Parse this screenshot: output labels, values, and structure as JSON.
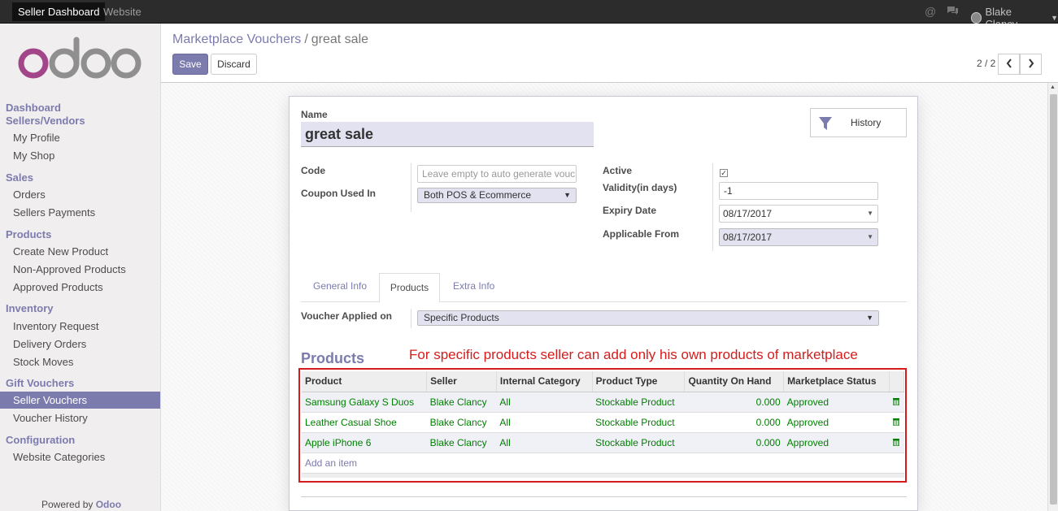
{
  "topbar": {
    "tabs": [
      "Seller Dashboard",
      "Website"
    ],
    "icons": [
      "at-icon",
      "chat-icon"
    ],
    "user_name": "Blake Clancy"
  },
  "sidebar": {
    "logo": "odoo",
    "sections": [
      {
        "head": "Dashboard",
        "items": []
      },
      {
        "head": "Sellers/Vendors",
        "items": [
          "My Profile",
          "My Shop"
        ]
      },
      {
        "head": "Sales",
        "items": [
          "Orders",
          "Sellers Payments"
        ]
      },
      {
        "head": "Products",
        "items": [
          "Create New Product",
          "Non-Approved Products",
          "Approved Products"
        ]
      },
      {
        "head": "Inventory",
        "items": [
          "Inventory Request",
          "Delivery Orders",
          "Stock Moves"
        ]
      },
      {
        "head": "Gift Vouchers",
        "items": [
          "Seller Vouchers",
          "Voucher History"
        ]
      },
      {
        "head": "Configuration",
        "items": [
          "Website Categories"
        ]
      }
    ],
    "active_item": "Seller Vouchers",
    "powered_prefix": "Powered by",
    "powered_brand": "Odoo"
  },
  "control": {
    "breadcrumb_parent": "Marketplace Vouchers",
    "breadcrumb_sep": "/",
    "breadcrumb_current": "great sale",
    "save_label": "Save",
    "discard_label": "Discard",
    "pager": "2 / 2"
  },
  "form": {
    "name_label": "Name",
    "name_value": "great sale",
    "history_label": "History",
    "code_label": "Code",
    "code_placeholder": "Leave empty to auto generate voucher code",
    "coupon_label": "Coupon Used In",
    "coupon_value": "Both POS & Ecommerce",
    "active_label": "Active",
    "active_checked": true,
    "validity_label": "Validity(in days)",
    "validity_value": "-1",
    "expiry_label": "Expiry Date",
    "expiry_value": "08/17/2017",
    "applicable_label": "Applicable From",
    "applicable_value": "08/17/2017",
    "tabs": [
      "General Info",
      "Products",
      "Extra Info"
    ],
    "active_tab": "Products",
    "applied_label": "Voucher Applied on",
    "applied_value": "Specific Products",
    "products_title": "Products",
    "annotation": "For specific products seller can add only his own products of marketplace",
    "columns": [
      "Product",
      "Seller",
      "Internal Category",
      "Product Type",
      "Quantity On Hand",
      "Marketplace Status"
    ],
    "rows": [
      {
        "product": "Samsung Galaxy S Duos",
        "seller": "Blake Clancy",
        "category": "All",
        "type": "Stockable Product",
        "qty": "0.000",
        "status": "Approved"
      },
      {
        "product": "Leather Casual Shoe",
        "seller": "Blake Clancy",
        "category": "All",
        "type": "Stockable Product",
        "qty": "0.000",
        "status": "Approved"
      },
      {
        "product": "Apple iPhone 6",
        "seller": "Blake Clancy",
        "category": "All",
        "type": "Stockable Product",
        "qty": "0.000",
        "status": "Approved"
      }
    ],
    "add_item": "Add an item"
  },
  "colors": {
    "accent": "#7c7bad",
    "topbar": "#2c2c2c",
    "annotation": "#d51c1c",
    "row_text": "#008000"
  }
}
